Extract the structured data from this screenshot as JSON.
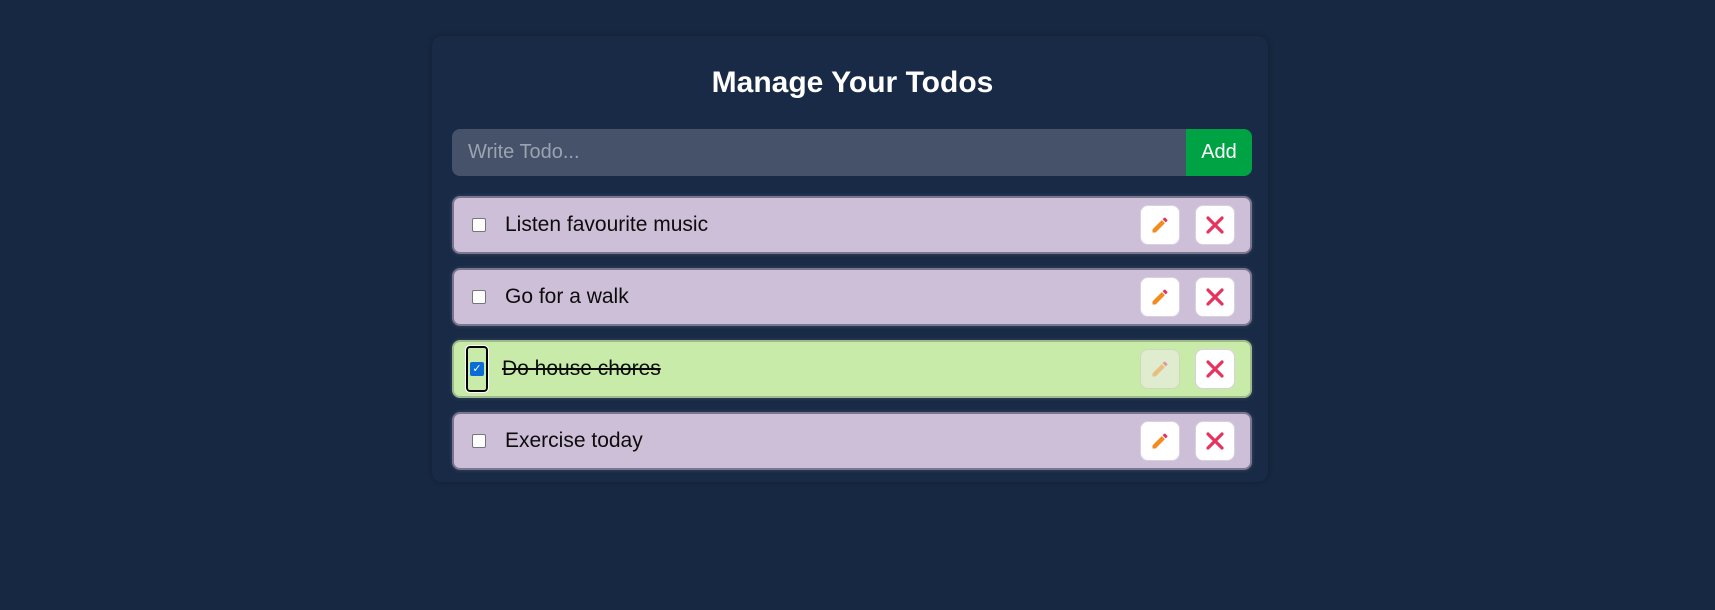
{
  "page": {
    "title": "Manage Your Todos"
  },
  "form": {
    "placeholder": "Write Todo...",
    "value": "",
    "add_label": "Add"
  },
  "todos": [
    {
      "text": "Listen favourite music",
      "completed": false
    },
    {
      "text": "Go for a walk",
      "completed": false
    },
    {
      "text": "Do house chores",
      "completed": true
    },
    {
      "text": "Exercise today",
      "completed": false
    }
  ],
  "icons": {
    "edit": "pencil-icon",
    "delete": "close-icon",
    "check": "checkmark-icon"
  },
  "colors": {
    "background": "#172842",
    "input_bg": "#455269",
    "add_button": "#00a344",
    "todo_bg": "#cebfd8",
    "todo_done_bg": "#c8ebaa",
    "pencil": "#f28a1e",
    "close": "#e8315b",
    "checkbox_checked": "#0a6cd6"
  }
}
